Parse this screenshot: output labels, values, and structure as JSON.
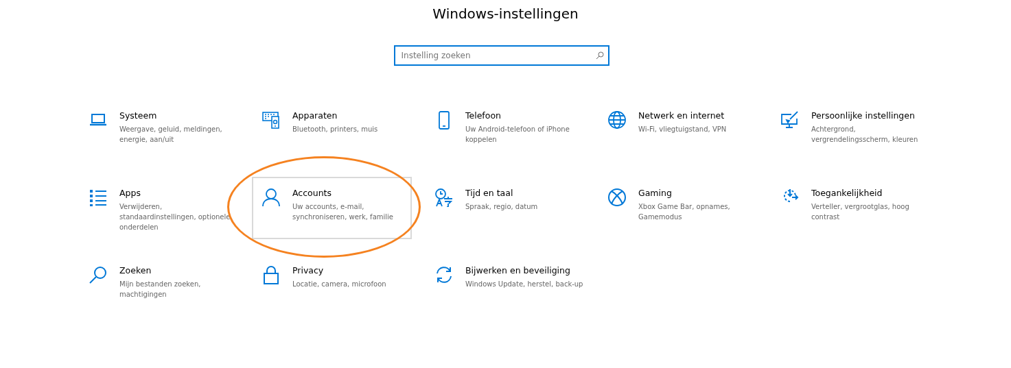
{
  "window": {
    "title": "Windows-instellingen"
  },
  "search": {
    "placeholder": "Instelling zoeken"
  },
  "tiles": [
    {
      "title": "Systeem",
      "description": "Weergave, geluid, meldingen, energie, aan/uit",
      "hovered": false,
      "circled": false
    },
    {
      "title": "Apparaten",
      "description": "Bluetooth, printers, muis",
      "hovered": false,
      "circled": false
    },
    {
      "title": "Telefoon",
      "description": "Uw Android-telefoon of iPhone koppelen",
      "hovered": false,
      "circled": false
    },
    {
      "title": "Netwerk en internet",
      "description": "Wi-Fi, vliegtuigstand, VPN",
      "hovered": false,
      "circled": false
    },
    {
      "title": "Persoonlijke instellingen",
      "description": "Achtergrond, vergrendelingsscherm, kleuren",
      "hovered": false,
      "circled": false
    },
    {
      "title": "Apps",
      "description": "Verwijderen, standaardinstellingen, optionele onderdelen",
      "hovered": false,
      "circled": false
    },
    {
      "title": "Accounts",
      "description": "Uw accounts, e-mail, synchroniseren, werk, familie",
      "hovered": true,
      "circled": true
    },
    {
      "title": "Tijd en taal",
      "description": "Spraak, regio, datum",
      "hovered": false,
      "circled": false
    },
    {
      "title": "Gaming",
      "description": "Xbox Game Bar, opnames, Gamemodus",
      "hovered": false,
      "circled": false
    },
    {
      "title": "Toegankelijkheid",
      "description": "Verteller, vergrootglas, hoog contrast",
      "hovered": false,
      "circled": false
    },
    {
      "title": "Zoeken",
      "description": "Mijn bestanden zoeken, machtigingen",
      "hovered": false,
      "circled": false
    },
    {
      "title": "Privacy",
      "description": "Locatie, camera, microfoon",
      "hovered": false,
      "circled": false
    },
    {
      "title": "Bijwerken en beveiliging",
      "description": "Windows Update, herstel, back-up",
      "hovered": false,
      "circled": false
    }
  ]
}
